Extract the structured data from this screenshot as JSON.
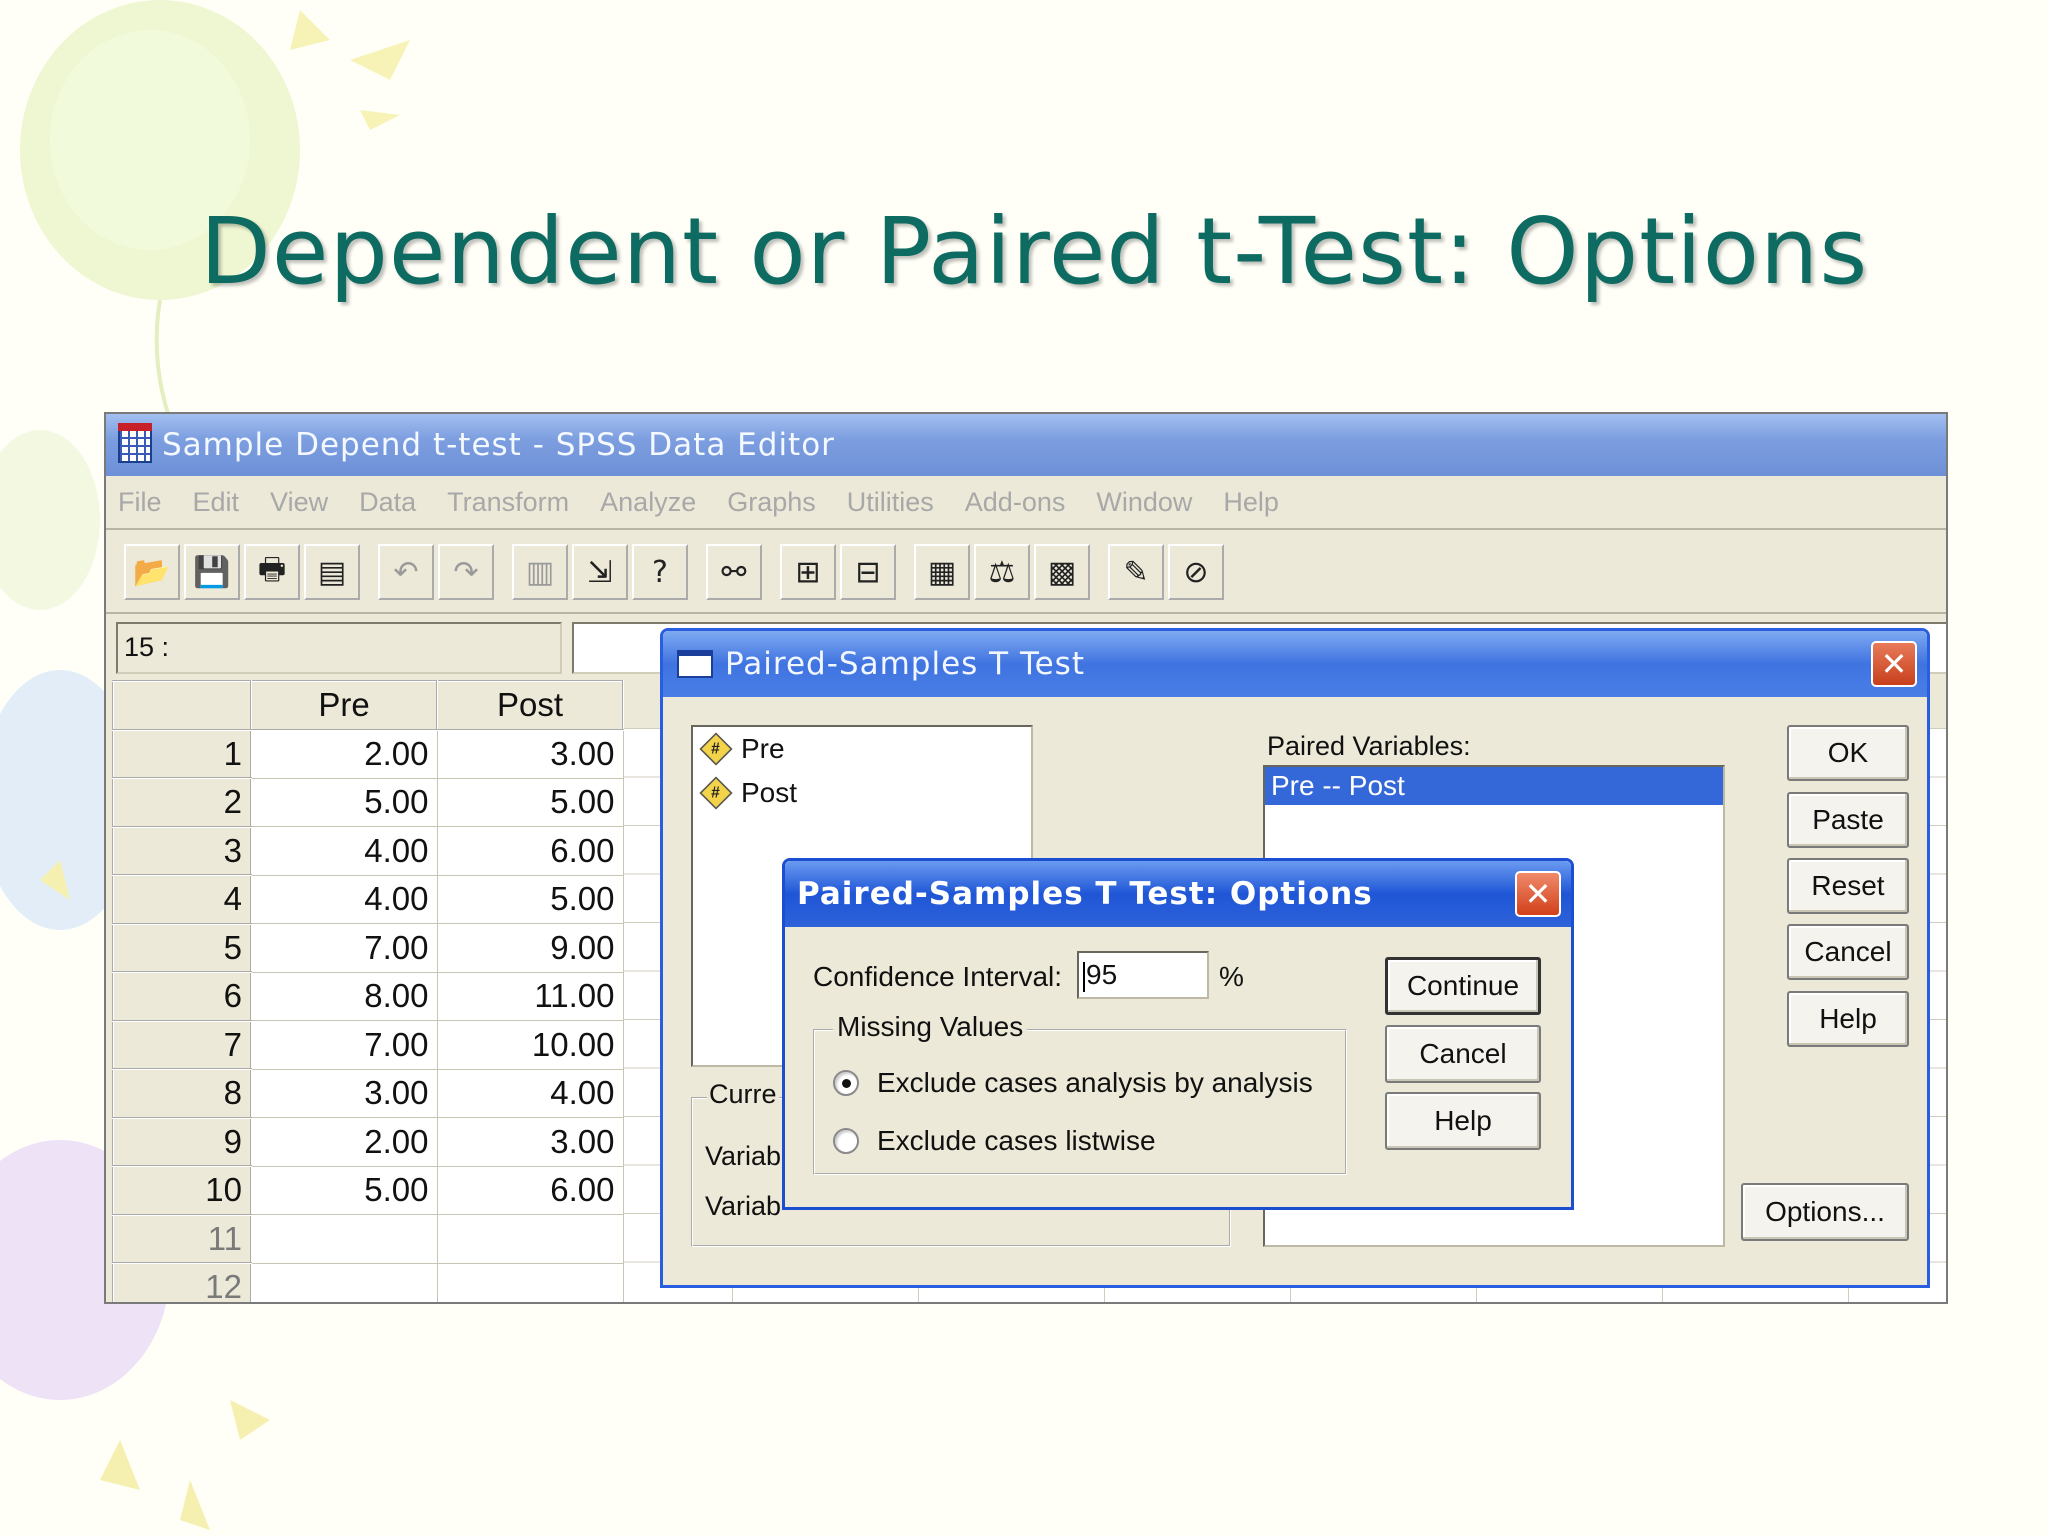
{
  "slide": {
    "title": "Dependent or Paired t-Test: Options"
  },
  "window": {
    "title": "Sample Depend t-test - SPSS Data Editor",
    "menu": [
      "File",
      "Edit",
      "View",
      "Data",
      "Transform",
      "Analyze",
      "Graphs",
      "Utilities",
      "Add-ons",
      "Window",
      "Help"
    ],
    "toolbar_icons": [
      "open-icon",
      "save-icon",
      "print-icon",
      "dialog-recall-icon",
      "undo-icon",
      "redo-icon",
      "goto-chart-icon",
      "goto-case-icon",
      "variables-icon",
      "find-icon",
      "insert-cases-icon",
      "insert-variable-icon",
      "split-file-icon",
      "weight-cases-icon",
      "select-cases-icon",
      "value-labels-icon",
      "use-sets-icon"
    ],
    "cell_ref": "15 :"
  },
  "grid": {
    "columns": [
      "Pre",
      "Post"
    ],
    "rows": [
      {
        "n": "1",
        "pre": "2.00",
        "post": "3.00"
      },
      {
        "n": "2",
        "pre": "5.00",
        "post": "5.00"
      },
      {
        "n": "3",
        "pre": "4.00",
        "post": "6.00"
      },
      {
        "n": "4",
        "pre": "4.00",
        "post": "5.00"
      },
      {
        "n": "5",
        "pre": "7.00",
        "post": "9.00"
      },
      {
        "n": "6",
        "pre": "8.00",
        "post": "11.00"
      },
      {
        "n": "7",
        "pre": "7.00",
        "post": "10.00"
      },
      {
        "n": "8",
        "pre": "3.00",
        "post": "4.00"
      },
      {
        "n": "9",
        "pre": "2.00",
        "post": "3.00"
      },
      {
        "n": "10",
        "pre": "5.00",
        "post": "6.00"
      },
      {
        "n": "11",
        "pre": "",
        "post": ""
      },
      {
        "n": "12",
        "pre": "",
        "post": ""
      }
    ]
  },
  "paired_dialog": {
    "title": "Paired-Samples T Test",
    "variables": [
      "Pre",
      "Post"
    ],
    "paired_label": "Paired Variables:",
    "paired_selected": "Pre -- Post",
    "current_label": "Curre",
    "var1_label": "Variab",
    "var2_label": "Variab",
    "buttons": {
      "ok": "OK",
      "paste": "Paste",
      "reset": "Reset",
      "cancel": "Cancel",
      "help": "Help",
      "options": "Options..."
    }
  },
  "options_dialog": {
    "title": "Paired-Samples T Test: Options",
    "ci_label": "Confidence Interval:",
    "ci_value": "95",
    "ci_unit": "%",
    "missing_legend": "Missing Values",
    "radio1": "Exclude cases analysis by analysis",
    "radio2": "Exclude cases listwise",
    "radio_selected": "Exclude cases analysis by analysis",
    "buttons": {
      "continue": "Continue",
      "cancel": "Cancel",
      "help": "Help"
    }
  }
}
